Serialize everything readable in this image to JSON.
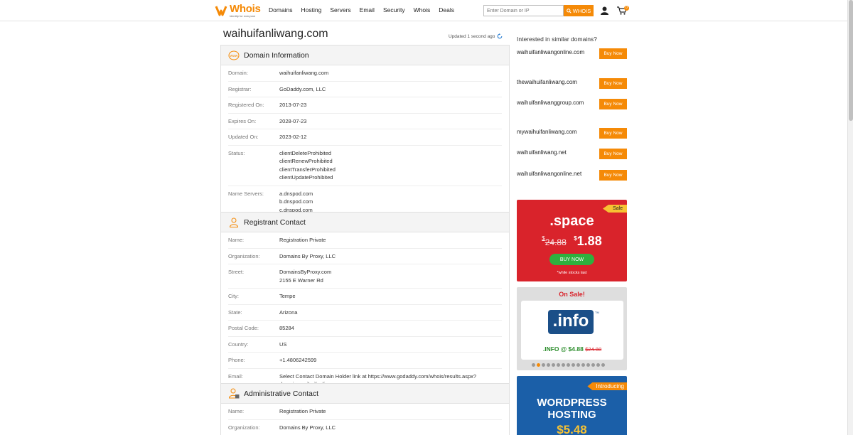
{
  "header": {
    "logo_text": "Whois",
    "logo_tagline": "Identity for everyone",
    "nav": [
      "Domains",
      "Hosting",
      "Servers",
      "Email",
      "Security",
      "Whois",
      "Deals"
    ],
    "search_placeholder": "Enter Domain or IP",
    "search_button": "WHOIS",
    "cart_count": "0"
  },
  "page": {
    "title": "waihuifanliwang.com",
    "updated": "Updated 1 second ago"
  },
  "domain_info": {
    "title": "Domain Information",
    "rows": [
      {
        "label": "Domain:",
        "values": [
          "waihuifanliwang.com"
        ]
      },
      {
        "label": "Registrar:",
        "values": [
          "GoDaddy.com, LLC"
        ]
      },
      {
        "label": "Registered On:",
        "values": [
          "2013-07-23"
        ]
      },
      {
        "label": "Expires On:",
        "values": [
          "2028-07-23"
        ]
      },
      {
        "label": "Updated On:",
        "values": [
          "2023-02-12"
        ]
      },
      {
        "label": "Status:",
        "values": [
          "clientDeleteProhibited",
          "clientRenewProhibited",
          "clientTransferProhibited",
          "clientUpdateProhibited"
        ]
      },
      {
        "label": "Name Servers:",
        "values": [
          "a.dnspod.com",
          "b.dnspod.com",
          "c.dnspod.com"
        ]
      }
    ]
  },
  "registrant": {
    "title": "Registrant Contact",
    "rows": [
      {
        "label": "Name:",
        "values": [
          "Registration Private"
        ]
      },
      {
        "label": "Organization:",
        "values": [
          "Domains By Proxy, LLC"
        ]
      },
      {
        "label": "Street:",
        "values": [
          "DomainsByProxy.com",
          "2155 E Warner Rd"
        ]
      },
      {
        "label": "City:",
        "values": [
          "Tempe"
        ]
      },
      {
        "label": "State:",
        "values": [
          "Arizona"
        ]
      },
      {
        "label": "Postal Code:",
        "values": [
          "85284"
        ]
      },
      {
        "label": "Country:",
        "values": [
          "US"
        ]
      },
      {
        "label": "Phone:",
        "values": [
          "+1.4806242599"
        ]
      },
      {
        "label": "Email:",
        "values": [
          "Select Contact Domain Holder link at https://www.godaddy.com/whois/results.aspx?",
          "domain=waihuifanliwang.com"
        ]
      }
    ]
  },
  "administrative": {
    "title": "Administrative Contact",
    "rows": [
      {
        "label": "Name:",
        "values": [
          "Registration Private"
        ]
      },
      {
        "label": "Organization:",
        "values": [
          "Domains By Proxy, LLC"
        ]
      }
    ]
  },
  "similar": {
    "heading": "Interested in similar domains?",
    "buy_label": "Buy Now",
    "domains": [
      "waihuifanliwangonline.com",
      "thewaihuifanliwang.com",
      "waihuifanliwanggroup.com",
      "mywaihuifanliwang.com",
      "waihuifanliwang.net",
      "waihuifanliwangonline.net"
    ]
  },
  "promo_space": {
    "tag": "Sale",
    "tld": ".space",
    "currency": "$",
    "old_price": "24.88",
    "new_price": "1.88",
    "button": "BUY NOW",
    "note": "*while stocks last"
  },
  "promo_info": {
    "heading": "On Sale!",
    "logo": ".info",
    "tm": "TM",
    "price_text": ".INFO @ $4.88",
    "old_price": "$24.88",
    "dot_count": 15,
    "active_dot": 1
  },
  "promo_wp": {
    "tag": "Introducing",
    "title_line1": "WORDPRESS",
    "title_line2": "HOSTING",
    "price": "$5.48"
  },
  "colors": {
    "accent": "#f58a07",
    "sale_red": "#d9232b",
    "green": "#2eb03e",
    "wp_blue": "#1b5fa8"
  }
}
